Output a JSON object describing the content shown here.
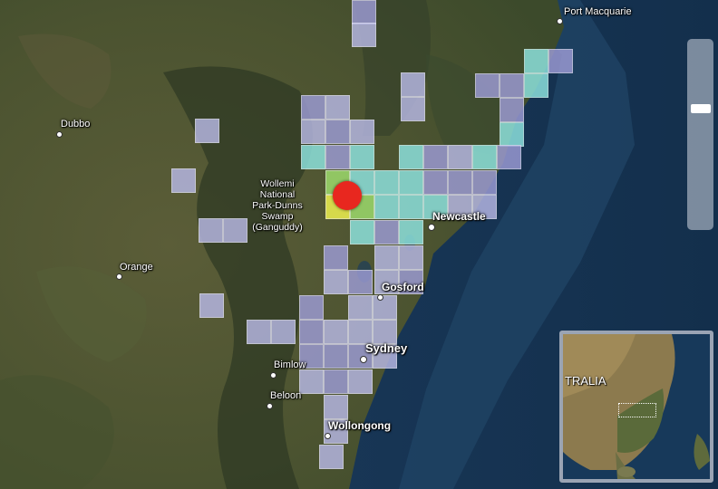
{
  "map": {
    "places": [
      {
        "id": "port-macquarie",
        "label": "Port Macquarie",
        "size": "small"
      },
      {
        "id": "dubbo",
        "label": "Dubbo",
        "size": "small"
      },
      {
        "id": "orange",
        "label": "Orange",
        "size": "small"
      },
      {
        "id": "newcastle",
        "label": "Newcastle",
        "size": "big"
      },
      {
        "id": "gosford",
        "label": "Gosford",
        "size": "big"
      },
      {
        "id": "sydney",
        "label": "Sydney",
        "size": "big"
      },
      {
        "id": "bimlow",
        "label": "Bimlow",
        "size": "small"
      },
      {
        "id": "beloon",
        "label": "Beloon",
        "size": "small"
      },
      {
        "id": "wollongong",
        "label": "Wollongong",
        "size": "big"
      }
    ],
    "park_label": [
      "Wollemi",
      "National",
      "Park-Dunns",
      "Swamp",
      "(Ganguddy)"
    ],
    "epicentre": {
      "label": "",
      "color": "#e8271f"
    },
    "intensity_colors": {
      "low": "#b8b9e6",
      "light": "#9d9cd6",
      "moderate": "#8fe6e2",
      "strong": "#9ad66a",
      "very_strong": "#e9ec4f"
    },
    "basemap": "satellite imagery"
  },
  "zoom_control": {
    "level": 0.65
  },
  "inset": {
    "label": "TRALIA",
    "highlight": "dotted extent box over New South Wales coast"
  }
}
